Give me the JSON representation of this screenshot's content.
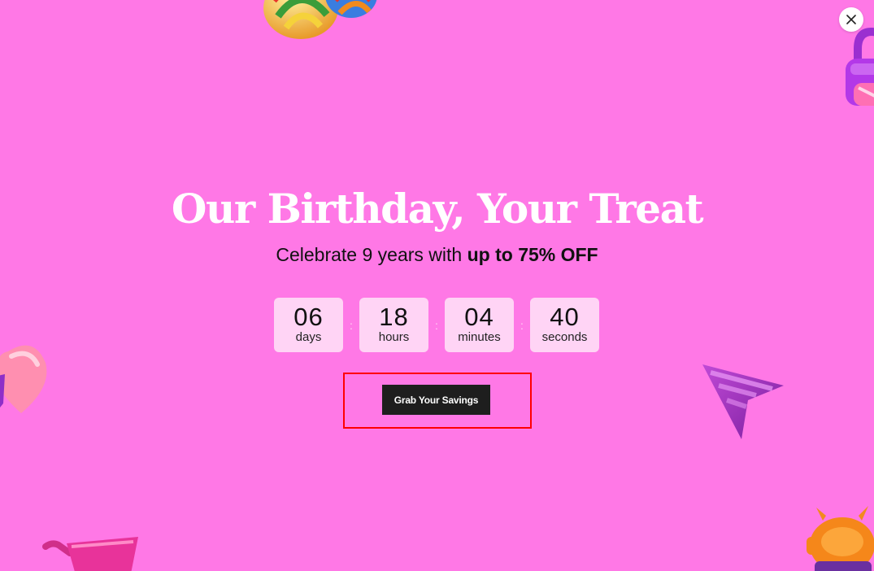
{
  "headline": "Our Birthday, Your Treat",
  "subline": {
    "prefix": "Celebrate 9 years with ",
    "emphasis": "up to 75% OFF"
  },
  "countdown": [
    {
      "value": "06",
      "label": "days"
    },
    {
      "value": "18",
      "label": "hours"
    },
    {
      "value": "04",
      "label": "minutes"
    },
    {
      "value": "40",
      "label": "seconds"
    }
  ],
  "separator": ":",
  "cta": {
    "label": "Grab Your Savings"
  },
  "close": {
    "icon": "close-icon"
  },
  "colors": {
    "background": "#ff78e6",
    "countdown_box": "#ffd4f5",
    "button": "#1e1e1e",
    "highlight": "#ff0000"
  },
  "decorations": [
    "lollipop-icon",
    "lock-icon",
    "heart-icon",
    "cursor-icon",
    "shopping-cart-icon",
    "monster-icon"
  ]
}
